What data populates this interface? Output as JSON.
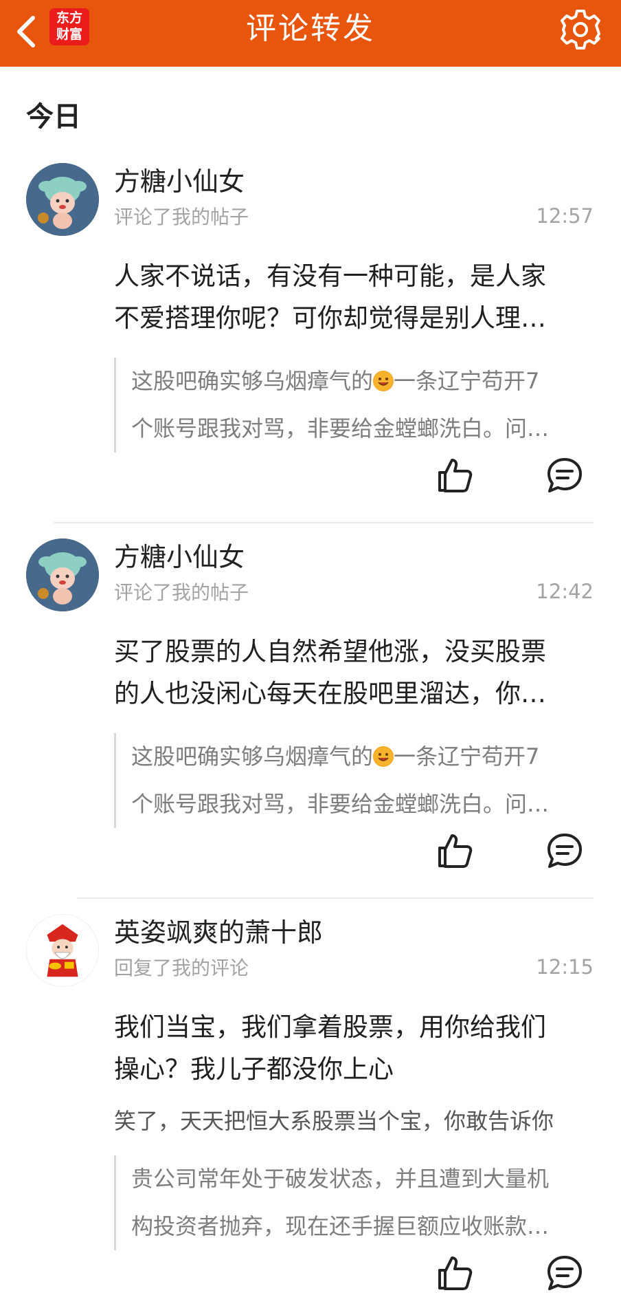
{
  "app": {
    "title": "评论转发",
    "logo_line1": "东方",
    "logo_line2": "财富"
  },
  "section": {
    "title": "今日"
  },
  "items": [
    {
      "username": "方糖小仙女",
      "action": "评论了我的帖子",
      "time": "12:57",
      "content_line1": "人家不说话，有没有一种可能，是人家",
      "content_line2": "不爱搭理你呢？可你却觉得是别人理…",
      "quote_line1a": "这股吧确实够乌烟瘴气的",
      "quote_line1b": "一条辽宁苟开7",
      "quote_line2": "个账号跟我对骂，非要给金螳螂洗白。问…",
      "quote_emoji": "grinning-emoji"
    },
    {
      "username": "方糖小仙女",
      "action": "评论了我的帖子",
      "time": "12:42",
      "content_line1": "买了股票的人自然希望他涨，没买股票",
      "content_line2": "的人也没闲心每天在股吧里溜达，你…",
      "quote_line1a": "这股吧确实够乌烟瘴气的",
      "quote_line1b": "一条辽宁苟开7",
      "quote_line2": "个账号跟我对骂，非要给金螳螂洗白。问…",
      "quote_emoji": "grinning-emoji"
    },
    {
      "username": "英姿飒爽的萧十郎",
      "action": "回复了我的评论",
      "time": "12:15",
      "content_line1": "我们当宝，我们拿着股票，用你给我们",
      "content_line2": "操心？我儿子都没你上心",
      "reply_line": "笑了，天天把恒大系股票当个宝，你敢告诉你",
      "quote_line1a": "贵公司常年处于破发状态，并且遭到大量机",
      "quote_line1b": "",
      "quote_line2": "构投资者抛弃，现在还手握巨额应收账款…"
    }
  ],
  "icons": {
    "back": "back-arrow-icon",
    "settings": "gear-icon",
    "like": "thumbs-up-icon",
    "reply": "comment-bubble-icon"
  },
  "colors": {
    "topbar": "#e8560e",
    "logo": "#ea1c1c",
    "muted_text": "#a3a3a3",
    "main_text": "#1f1f1f"
  }
}
